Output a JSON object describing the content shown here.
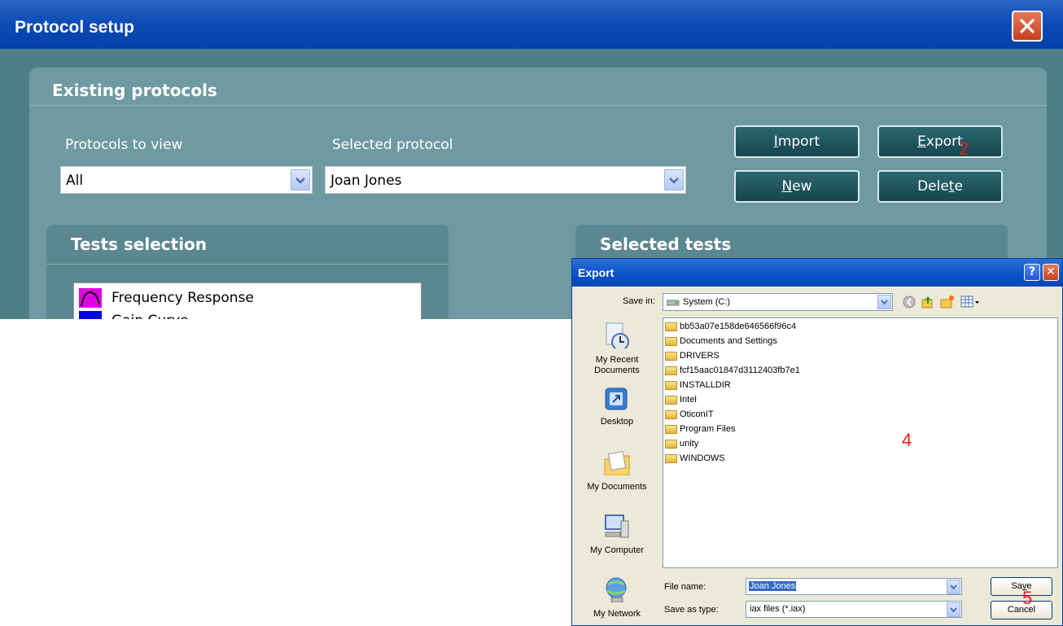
{
  "protocol_window": {
    "title": "Protocol setup",
    "existing_protocols": {
      "heading": "Existing protocols",
      "protocols_to_view_label": "Protocols to view",
      "protocols_to_view_value": "All",
      "selected_protocol_label": "Selected protocol",
      "selected_protocol_value": "Joan Jones",
      "buttons": {
        "import_mnemonic": "I",
        "import_rest": "mport",
        "export_pre": "E",
        "export_rest": "xport",
        "new_mnemonic": "N",
        "new_rest": "ew",
        "delete_pre": "Dele",
        "delete_mnemonic": "t",
        "delete_post": "e"
      }
    },
    "tests_selection": {
      "heading": "Tests selection",
      "items": [
        "Frequency Response",
        "Gain Curve"
      ]
    },
    "selected_tests": {
      "heading": "Selected tests"
    }
  },
  "annotations": {
    "export_step": "2",
    "file_list_step": "4",
    "save_step": "5"
  },
  "export_dialog": {
    "title": "Export",
    "help_glyph": "?",
    "close_glyph": "✕",
    "save_in_label": "Save in:",
    "save_in_value": "System (C:)",
    "places": [
      {
        "label_line1": "My Recent",
        "label_line2": "Documents",
        "icon": "recent-documents-icon"
      },
      {
        "label_line1": "Desktop",
        "label_line2": "",
        "icon": "desktop-icon"
      },
      {
        "label_line1": "My Documents",
        "label_line2": "",
        "icon": "my-documents-icon"
      },
      {
        "label_line1": "My Computer",
        "label_line2": "",
        "icon": "my-computer-icon"
      },
      {
        "label_line1": "My Network",
        "label_line2": "",
        "icon": "my-network-icon"
      }
    ],
    "files": [
      "bb53a07e158de646566f96c4",
      "Documents and Settings",
      "DRIVERS",
      "fcf15aac01847d3112403fb7e1",
      "INSTALLDIR",
      "Intel",
      "OticonIT",
      "Program Files",
      "unity",
      "WINDOWS"
    ],
    "file_name_label": "File name:",
    "file_name_value": "Joan Jones",
    "save_as_type_label": "Save as type:",
    "save_as_type_value": "iax files (*.iax)",
    "save_pre": "Sa",
    "save_mnemonic": "v",
    "save_post": "e",
    "cancel_label": "Cancel"
  },
  "colors": {
    "xp_title_blue": "#0a52c9",
    "panel_teal": "#4e7f89",
    "annotation_red": "#e41b1b"
  }
}
